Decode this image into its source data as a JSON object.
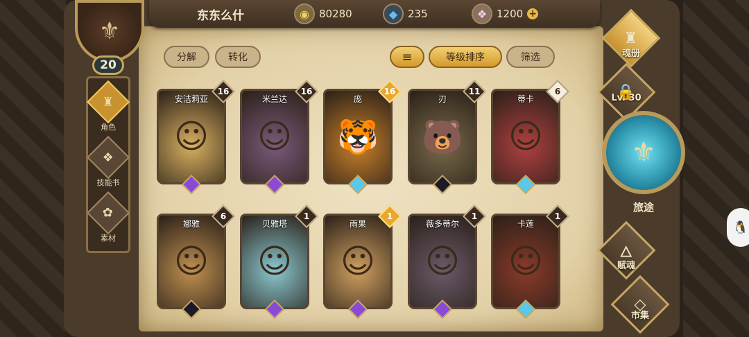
{
  "header": {
    "player_name": "东东么什",
    "gold": "80280",
    "crystal": "235",
    "gems": "1200",
    "plus": "+"
  },
  "player": {
    "level": "20"
  },
  "sidenav": [
    {
      "label": "角色",
      "icon": "helmet-icon",
      "glyph": "♜",
      "active": true
    },
    {
      "label": "技能书",
      "icon": "skill-book-icon",
      "glyph": "❖",
      "active": false
    },
    {
      "label": "素材",
      "icon": "material-icon",
      "glyph": "✿",
      "active": false
    }
  ],
  "toolbar": {
    "decompose": "分解",
    "convert": "转化",
    "sort_icon": "≡",
    "sort_level": "等级排序",
    "filter": "筛选"
  },
  "cards": [
    {
      "name": "安洁莉亚",
      "count": "16",
      "badge": "dark",
      "gem": "purple",
      "color": "#d8b060",
      "glyph": "☺"
    },
    {
      "name": "米兰达",
      "count": "16",
      "badge": "dark",
      "gem": "purple",
      "color": "#7a5a7a",
      "glyph": "☺"
    },
    {
      "name": "庞",
      "count": "16",
      "badge": "gold",
      "gem": "blue",
      "color": "#c8802a",
      "glyph": "🐯"
    },
    {
      "name": "刃",
      "count": "11",
      "badge": "dark",
      "gem": "dark",
      "color": "#7a6a4a",
      "glyph": "🐻"
    },
    {
      "name": "蒂卡",
      "count": "6",
      "badge": "white",
      "gem": "blue",
      "color": "#b04040",
      "glyph": "☺"
    },
    {
      "name": "娜雅",
      "count": "6",
      "badge": "dark",
      "gem": "dark",
      "color": "#c09050",
      "glyph": "☺"
    },
    {
      "name": "贝雅塔",
      "count": "1",
      "badge": "dark",
      "gem": "purple",
      "color": "#8ac8d0",
      "glyph": "☺"
    },
    {
      "name": "雨果",
      "count": "1",
      "badge": "gold",
      "gem": "purple",
      "color": "#d0a060",
      "glyph": "☺"
    },
    {
      "name": "薇多蒂尔",
      "count": "1",
      "badge": "dark",
      "gem": "purple",
      "color": "#6a5a6a",
      "glyph": "☺"
    },
    {
      "name": "卡莲",
      "count": "1",
      "badge": "dark",
      "gem": "blue",
      "color": "#8a3a2a",
      "glyph": "☺"
    }
  ],
  "right_panel": {
    "soul_book": "魂册",
    "locked_level": "Lv. 30",
    "journey": "旅途",
    "endow_soul": "赋魂",
    "market": "市集"
  }
}
